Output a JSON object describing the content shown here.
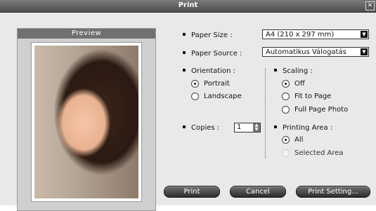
{
  "window": {
    "title": "Print",
    "close_icon": "close-icon"
  },
  "preview": {
    "header": "Preview"
  },
  "paper_size": {
    "label": "Paper Size :",
    "value": "A4 (210 x 297 mm)"
  },
  "paper_source": {
    "label": "Paper Source :",
    "value": "Automatikus Válogatás"
  },
  "orientation": {
    "label": "Orientation :",
    "options": [
      {
        "label": "Portrait",
        "selected": true
      },
      {
        "label": "Landscape",
        "selected": false
      }
    ]
  },
  "scaling": {
    "label": "Scaling :",
    "options": [
      {
        "label": "Off",
        "selected": true
      },
      {
        "label": "Fit to Page",
        "selected": false
      },
      {
        "label": "Full Page Photo",
        "selected": false
      }
    ]
  },
  "copies": {
    "label": "Copies :",
    "value": "1"
  },
  "printing_area": {
    "label": "Printing Area :",
    "options": [
      {
        "label": "All",
        "selected": true,
        "enabled": true
      },
      {
        "label": "Selected Area",
        "selected": false,
        "enabled": false
      }
    ]
  },
  "buttons": {
    "print": "Print",
    "cancel": "Cancel",
    "settings": "Print Setting..."
  },
  "icons": {
    "dropdown": "chevron-down-icon",
    "spinner": "spinner-arrows-icon"
  }
}
